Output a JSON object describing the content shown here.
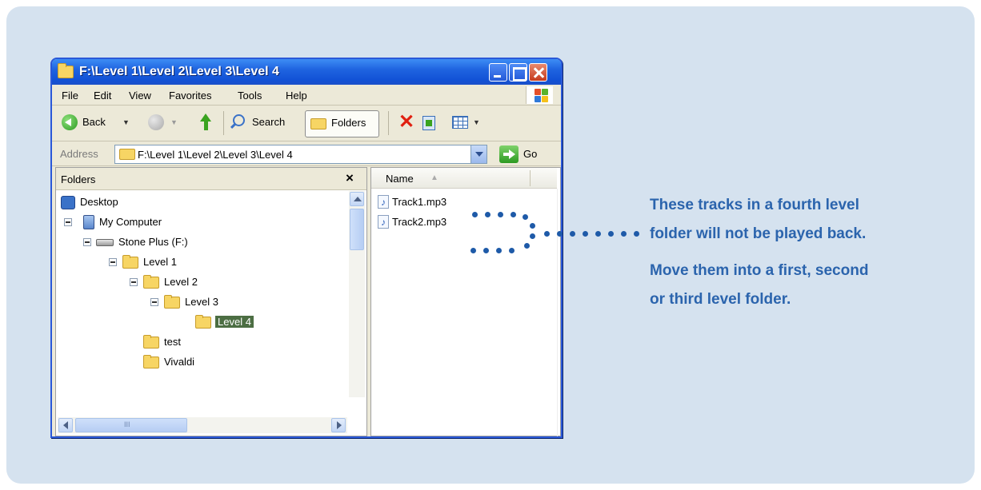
{
  "window": {
    "title": "F:\\Level 1\\Level 2\\Level 3\\Level 4"
  },
  "menubar": {
    "items": [
      "File",
      "Edit",
      "View",
      "Favorites",
      "Tools",
      "Help"
    ]
  },
  "toolbar": {
    "back_label": "Back",
    "search_label": "Search",
    "folders_label": "Folders"
  },
  "addressbar": {
    "label": "Address",
    "path": "F:\\Level 1\\Level 2\\Level 3\\Level 4",
    "go_label": "Go"
  },
  "folders_pane": {
    "title": "Folders",
    "close_glyph": "×",
    "tree": [
      {
        "label": "Desktop",
        "icon": "desktop-icon"
      },
      {
        "label": "My Computer",
        "icon": "computer-icon"
      },
      {
        "label": "Stone Plus (F:)",
        "icon": "drive-icon"
      },
      {
        "label": "Level 1",
        "icon": "folder-icon"
      },
      {
        "label": "Level 2",
        "icon": "folder-icon"
      },
      {
        "label": "Level 3",
        "icon": "folder-icon"
      },
      {
        "label": "Level 4",
        "icon": "folder-icon",
        "selected": true
      },
      {
        "label": "test",
        "icon": "folder-icon"
      },
      {
        "label": "Vivaldi",
        "icon": "folder-icon"
      }
    ],
    "hscroll_grip": "III"
  },
  "files_pane": {
    "column_name": "Name",
    "sort_glyph": "▲",
    "files": [
      {
        "name": "Track1.mp3",
        "icon": "music-file-icon"
      },
      {
        "name": "Track2.mp3",
        "icon": "music-file-icon"
      }
    ]
  },
  "callout": {
    "line1": "These tracks in a fourth level",
    "line2": "folder will not be played back.",
    "line3": "Move them into a first, second",
    "line4": "or third level folder."
  },
  "colors": {
    "background_panel": "#d5e2ef",
    "callout_text": "#2b64ad",
    "dots": "#1e5aa8",
    "titlebar": "#1f64e0",
    "selection": "#4c6e43"
  }
}
